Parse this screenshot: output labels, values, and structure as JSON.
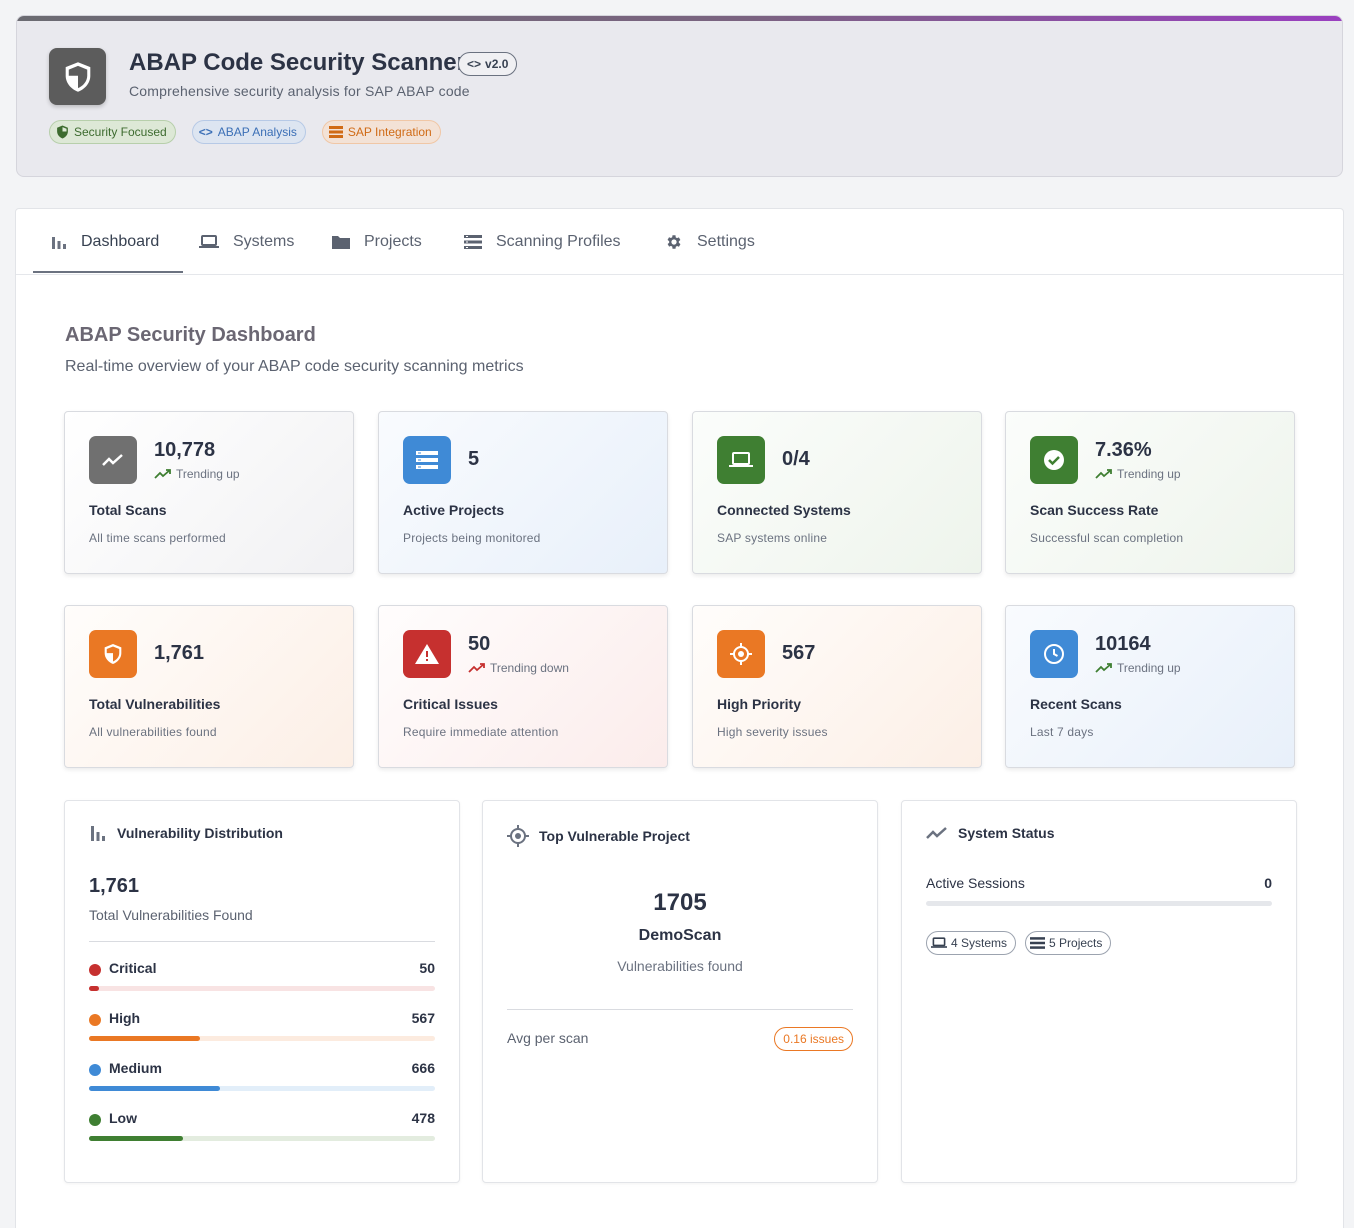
{
  "header": {
    "title": "ABAP Code Security Scanner",
    "version": "v2.0",
    "subtitle": "Comprehensive security analysis for SAP ABAP code",
    "tags": [
      "Security Focused",
      "ABAP Analysis",
      "SAP Integration"
    ]
  },
  "tabs": [
    {
      "label": "Dashboard",
      "icon": "bar-chart-icon",
      "active": true
    },
    {
      "label": "Systems",
      "icon": "laptop-icon"
    },
    {
      "label": "Projects",
      "icon": "folder-icon"
    },
    {
      "label": "Scanning Profiles",
      "icon": "list-icon"
    },
    {
      "label": "Settings",
      "icon": "gear-icon"
    }
  ],
  "dashboard": {
    "title": "ABAP Security Dashboard",
    "subtitle": "Real-time overview of your ABAP code security scanning metrics"
  },
  "stats": [
    {
      "value": "10,778",
      "trend": "Trending up",
      "label": "Total Scans",
      "desc": "All time scans performed",
      "icon": "trending-icon",
      "color": "#707070"
    },
    {
      "value": "5",
      "label": "Active Projects",
      "desc": "Projects being monitored",
      "icon": "list-icon",
      "color": "#3f8ad6"
    },
    {
      "value": "0/4",
      "label": "Connected Systems",
      "desc": "SAP systems online",
      "icon": "laptop-icon",
      "color": "#3f7f32"
    },
    {
      "value": "7.36%",
      "trend": "Trending up",
      "label": "Scan Success Rate",
      "desc": "Successful scan completion",
      "icon": "check-circle-icon",
      "color": "#3f7f32"
    },
    {
      "value": "1,761",
      "label": "Total Vulnerabilities",
      "desc": "All vulnerabilities found",
      "icon": "shield-icon",
      "color": "#ea7824"
    },
    {
      "value": "50",
      "trend": "Trending down",
      "label": "Critical Issues",
      "desc": "Require immediate attention",
      "icon": "warning-icon",
      "color": "#c6302f"
    },
    {
      "value": "567",
      "label": "High Priority",
      "desc": "High severity issues",
      "icon": "target-icon",
      "color": "#ea7824"
    },
    {
      "value": "10164",
      "trend": "Trending up",
      "label": "Recent Scans",
      "desc": "Last 7 days",
      "icon": "clock-icon",
      "color": "#3f8ad6"
    }
  ],
  "vuln_distribution": {
    "title": "Vulnerability Distribution",
    "total": "1,761",
    "total_label": "Total Vulnerabilities Found",
    "severities": [
      {
        "name": "Critical",
        "count": "50",
        "fraction": 0.028,
        "color": "#c6302f",
        "track": "#f8e3e3"
      },
      {
        "name": "High",
        "count": "567",
        "fraction": 0.322,
        "color": "#ea7824",
        "track": "#fcebdf"
      },
      {
        "name": "Medium",
        "count": "666",
        "fraction": 0.378,
        "color": "#3f8ad6",
        "track": "#e2eef9"
      },
      {
        "name": "Low",
        "count": "478",
        "fraction": 0.271,
        "color": "#3f7f32",
        "track": "#e3ecdf"
      }
    ]
  },
  "top_project": {
    "title": "Top Vulnerable Project",
    "count": "1705",
    "name": "DemoScan",
    "label": "Vulnerabilities found",
    "avg_label": "Avg per scan",
    "avg_value": "0.16 issues"
  },
  "system_status": {
    "title": "System Status",
    "sessions_label": "Active Sessions",
    "sessions_value": "0",
    "systems_chip": "4 Systems",
    "projects_chip": "5 Projects"
  }
}
